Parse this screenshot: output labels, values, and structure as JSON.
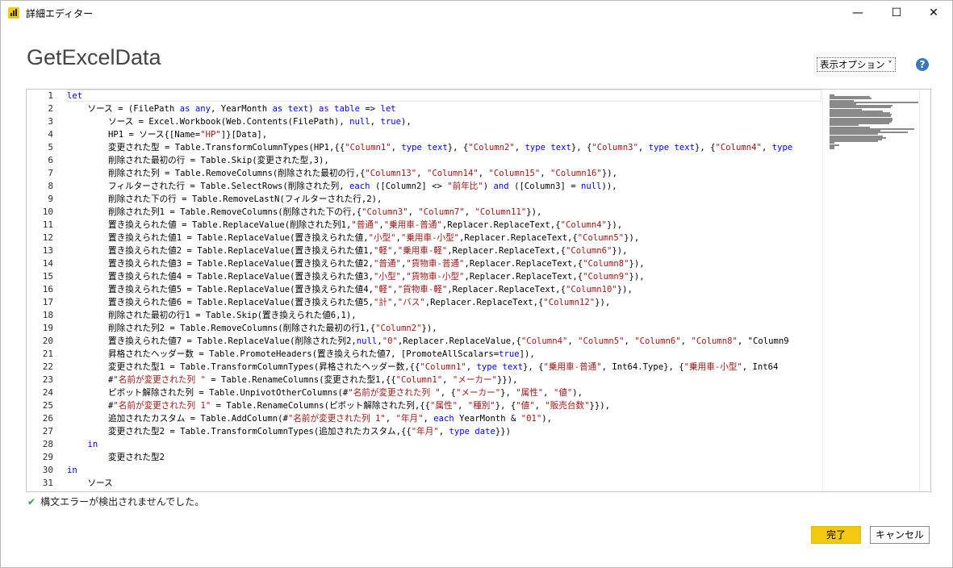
{
  "window": {
    "title": "詳細エディター",
    "minimize_glyph": "—",
    "maximize_glyph": "☐",
    "close_glyph": "✕"
  },
  "header": {
    "query_name": "GetExcelData",
    "display_options": "表示オプション ˅",
    "help_glyph": "?"
  },
  "editor": {
    "line_numbers": [
      "1",
      "2",
      "3",
      "4",
      "5",
      "6",
      "7",
      "8",
      "9",
      "10",
      "11",
      "12",
      "13",
      "14",
      "15",
      "16",
      "17",
      "18",
      "19",
      "20",
      "21",
      "22",
      "23",
      "24",
      "25",
      "26",
      "27",
      "28",
      "29",
      "30",
      "31"
    ],
    "lines": [
      "let",
      "    ソース = (FilePath as any, YearMonth as text) as table => let",
      "        ソース = Excel.Workbook(Web.Contents(FilePath), null, true),",
      "        HP1 = ソース{[Name=\"HP\"]}[Data],",
      "        変更された型 = Table.TransformColumnTypes(HP1,{{\"Column1\", type text}, {\"Column2\", type text}, {\"Column3\", type text}, {\"Column4\", type",
      "        削除された最初の行 = Table.Skip(変更された型,3),",
      "        削除された列 = Table.RemoveColumns(削除された最初の行,{\"Column13\", \"Column14\", \"Column15\", \"Column16\"}),",
      "        フィルターされた行 = Table.SelectRows(削除された列, each ([Column2] <> \"前年比\") and ([Column3] = null)),",
      "        削除された下の行 = Table.RemoveLastN(フィルターされた行,2),",
      "        削除された列1 = Table.RemoveColumns(削除された下の行,{\"Column3\", \"Column7\", \"Column11\"}),",
      "        置き換えられた値 = Table.ReplaceValue(削除された列1,\"普通\",\"乗用車-普通\",Replacer.ReplaceText,{\"Column4\"}),",
      "        置き換えられた値1 = Table.ReplaceValue(置き換えられた値,\"小型\",\"乗用車-小型\",Replacer.ReplaceText,{\"Column5\"}),",
      "        置き換えられた値2 = Table.ReplaceValue(置き換えられた値1,\"軽\",\"乗用車-軽\",Replacer.ReplaceText,{\"Column6\"}),",
      "        置き換えられた値3 = Table.ReplaceValue(置き換えられた値2,\"普通\",\"貨物車-普通\",Replacer.ReplaceText,{\"Column8\"}),",
      "        置き換えられた値4 = Table.ReplaceValue(置き換えられた値3,\"小型\",\"貨物車-小型\",Replacer.ReplaceText,{\"Column9\"}),",
      "        置き換えられた値5 = Table.ReplaceValue(置き換えられた値4,\"軽\",\"貨物車-軽\",Replacer.ReplaceText,{\"Column10\"}),",
      "        置き換えられた値6 = Table.ReplaceValue(置き換えられた値5,\"計\",\"バス\",Replacer.ReplaceText,{\"Column12\"}),",
      "        削除された最初の行1 = Table.Skip(置き換えられた値6,1),",
      "        削除された列2 = Table.RemoveColumns(削除された最初の行1,{\"Column2\"}),",
      "        置き換えられた値7 = Table.ReplaceValue(削除された列2,null,\"0\",Replacer.ReplaceValue,{\"Column4\", \"Column5\", \"Column6\", \"Column8\", \"Column9",
      "        昇格されたヘッダー数 = Table.PromoteHeaders(置き換えられた値7, [PromoteAllScalars=true]),",
      "        変更された型1 = Table.TransformColumnTypes(昇格されたヘッダー数,{{\"Column1\", type text}, {\"乗用車-普通\", Int64.Type}, {\"乗用車-小型\", Int64",
      "        #\"名前が変更された列 \" = Table.RenameColumns(変更された型1,{{\"Column1\", \"メーカー\"}}),",
      "        ピボット解除された列 = Table.UnpivotOtherColumns(#\"名前が変更された列 \", {\"メーカー\"}, \"属性\", \"値\"),",
      "        #\"名前が変更された列 1\" = Table.RenameColumns(ピボット解除された列,{{\"属性\", \"種別\"}, {\"値\", \"販売台数\"}}),",
      "        追加されたカスタム = Table.AddColumn(#\"名前が変更された列 1\", \"年月\", each YearMonth & \"01\"),",
      "        変更された型2 = Table.TransformColumnTypes(追加されたカスタム,{{\"年月\", type date}})",
      "    in",
      "        変更された型2",
      "in",
      "    ソース"
    ]
  },
  "status": {
    "check_glyph": "✔",
    "message": "構文エラーが検出されませんでした。"
  },
  "buttons": {
    "done": "完了",
    "cancel": "キャンセル"
  },
  "colors": {
    "keyword": "#0000ff",
    "string": "#a31515",
    "accent": "#f2c811"
  }
}
